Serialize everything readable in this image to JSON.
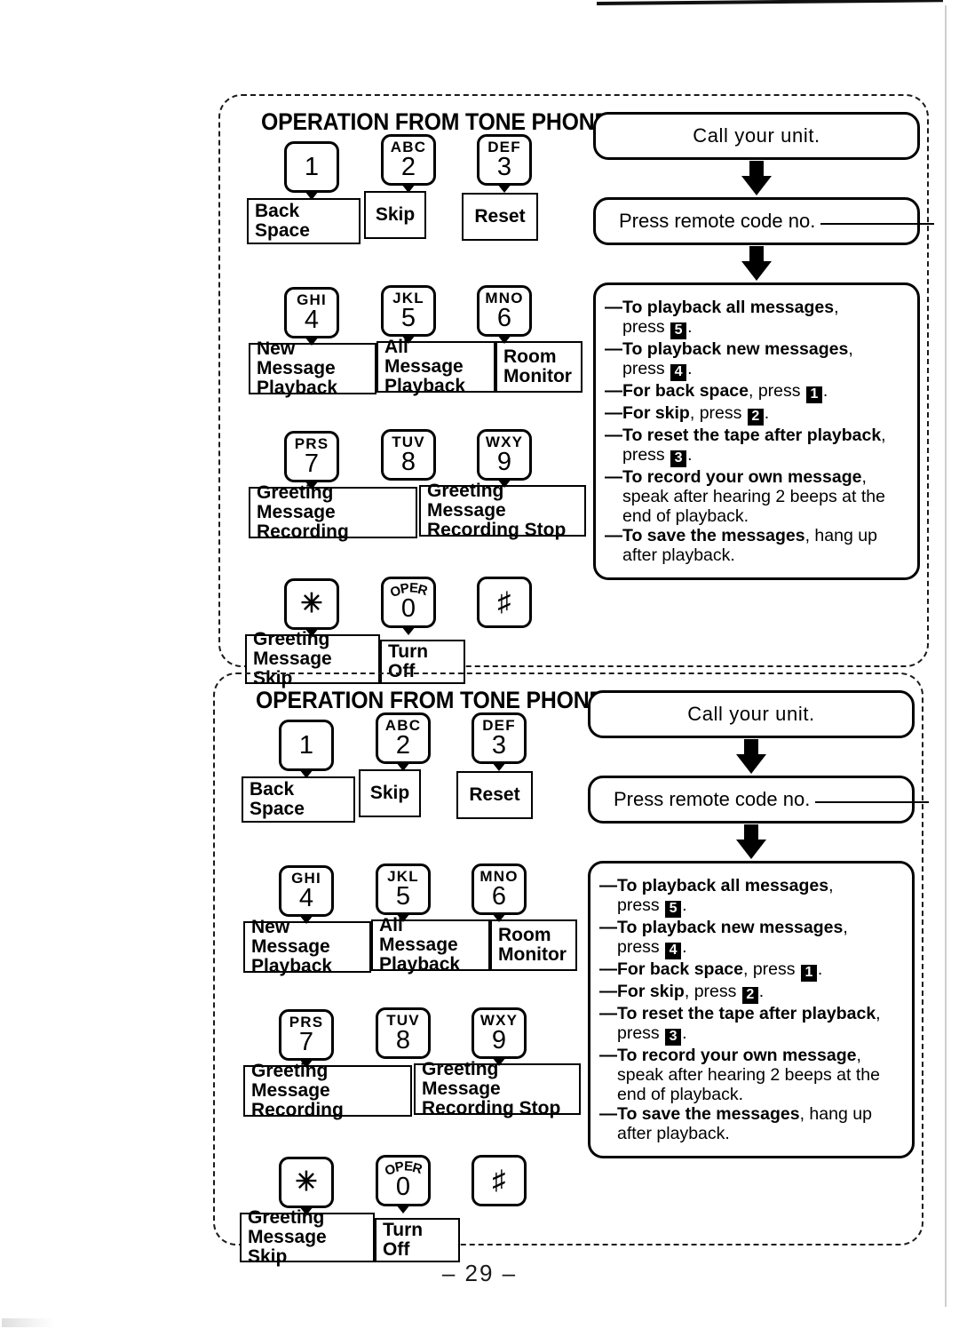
{
  "page": {
    "number": "– 29 –"
  },
  "card": {
    "title": "OPERATION FROM TONE PHONE",
    "keys": [
      {
        "letters": "",
        "digit": "1",
        "label": "Back Space"
      },
      {
        "letters": "ABC",
        "digit": "2",
        "label": "Skip"
      },
      {
        "letters": "DEF",
        "digit": "3",
        "label": "Reset"
      },
      {
        "letters": "GHI",
        "digit": "4",
        "label_line1": "New Message",
        "label_line2": "Playback"
      },
      {
        "letters": "JKL",
        "digit": "5",
        "label_line1": "All Message",
        "label_line2": "Playback"
      },
      {
        "letters": "MNO",
        "digit": "6",
        "label_line1": "Room",
        "label_line2": "Monitor"
      },
      {
        "letters": "PRS",
        "digit": "7",
        "label_line1": "Greeting Message",
        "label_line2": "Recording"
      },
      {
        "letters": "TUV",
        "digit": "8",
        "label": ""
      },
      {
        "letters": "WXY",
        "digit": "9",
        "label_line1": "Greeting Message",
        "label_line2": "Recording Stop"
      },
      {
        "letters": "",
        "digit": "✳",
        "label_line1": "Greeting",
        "label_line2": "Message Skip"
      },
      {
        "letters": "OPER",
        "digit": "0",
        "label": "Turn Off"
      },
      {
        "letters": "",
        "digit": "♯",
        "label": ""
      }
    ],
    "flow": {
      "step1": "Call your unit.",
      "step2": "Press remote code no.",
      "instructions": [
        {
          "bold": "To playback all messages",
          "after": ",",
          "cont_pre": "press ",
          "cont_key": "5",
          "cont_post": "."
        },
        {
          "bold": "To playback new messages",
          "after": ",",
          "cont_pre": "press ",
          "cont_key": "4",
          "cont_post": "."
        },
        {
          "bold": "For back space",
          "after": ", press ",
          "key": "1",
          "tail": "."
        },
        {
          "bold": "For skip",
          "after": ", press ",
          "key": "2",
          "tail": "."
        },
        {
          "bold": "To reset the tape after playback",
          "after": ",",
          "cont_pre": "press ",
          "cont_key": "3",
          "cont_post": "."
        },
        {
          "bold": "To record your own message",
          "after": ",",
          "cont_text": "speak after hearing 2 beeps at the end of playback."
        },
        {
          "bold": "To save the messages",
          "after": ", hang up",
          "cont_text": "after playback."
        }
      ]
    }
  }
}
